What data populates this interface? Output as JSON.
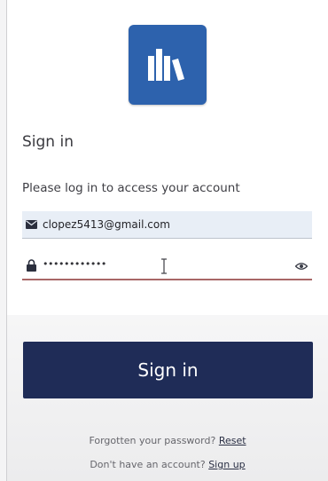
{
  "header": {
    "title": "Sign in",
    "subtitle": "Please log in to access your account"
  },
  "icons": {
    "logo": "library-books-icon",
    "email": "envelope-icon",
    "password": "lock-icon",
    "visibility": "eye-icon",
    "cursor": "text-cursor-icon"
  },
  "form": {
    "email_value": "clopez5413@gmail.com",
    "password_value": "••••••••••••",
    "submit_label": "Sign in"
  },
  "footer": {
    "forgot_text": "Forgotten your password?",
    "reset_link": "Reset",
    "no_account_text": "Don't have an account?",
    "signup_link": "Sign up"
  },
  "colors": {
    "brand_blue": "#2d62ad",
    "button_navy": "#1f2c57",
    "email_field_bg": "#e8eef6",
    "password_underline": "#a86767"
  }
}
